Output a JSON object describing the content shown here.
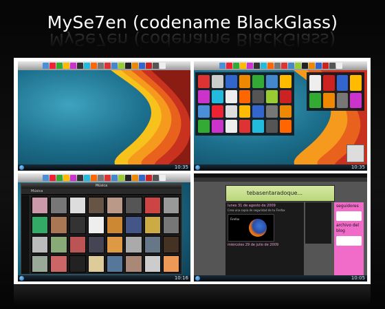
{
  "page": {
    "title": "MySe7en (codename BlackGlass)"
  },
  "screens": {
    "desktop": {
      "clock": "10:35"
    },
    "launcher": {
      "clock": "10:35"
    },
    "media_library": {
      "window_title": "Música",
      "breadcrumb": "Música",
      "clock": "10:16"
    },
    "browser": {
      "clock": "10:05",
      "blog": {
        "header_text": "tebasentaradoque...",
        "post1_title": "lunes 31 de agosto de 2009",
        "post1_subtitle": "Crea una copia de seguridad de tu Firefox",
        "post1_image_label": "Firefox",
        "post2_title": "miércoles 29 de julio de 2009",
        "sidebar_heading1": "seguidores",
        "sidebar_heading2": "archivo del blog"
      }
    }
  },
  "colors": {
    "wave_orange": "#f59a1c",
    "wave_red": "#c8321e",
    "desktop_teal": "#1c6f8c",
    "blog_pink": "#f06cc8"
  }
}
